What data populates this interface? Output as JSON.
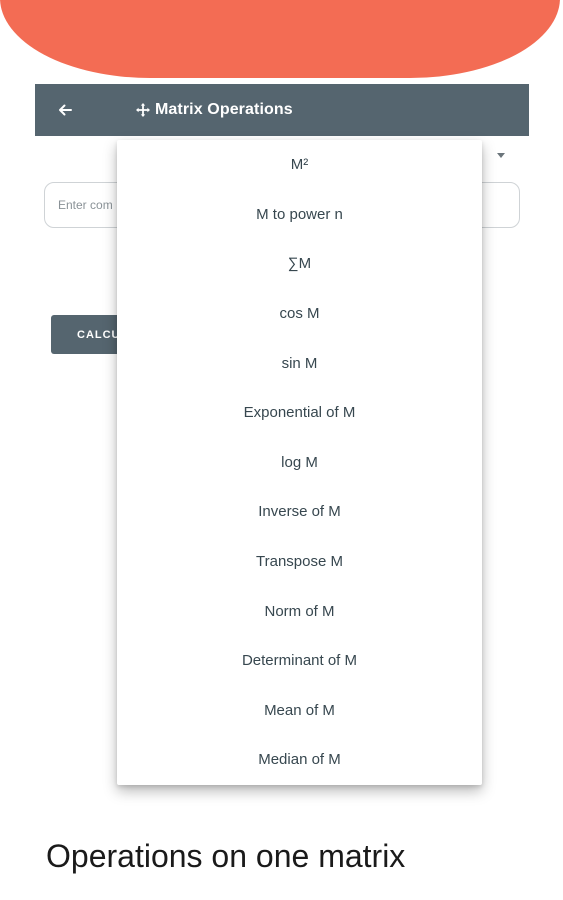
{
  "header": {
    "title": "Matrix Operations",
    "back_icon": "arrow-left-icon",
    "title_icon": "move-icon"
  },
  "form": {
    "input_placeholder": "Enter com",
    "calculate_label": "CALCU"
  },
  "dropdown": {
    "options": [
      "M²",
      "M to power n",
      "∑M",
      "cos M",
      "sin M",
      "Exponential of M",
      "log M",
      "Inverse of M",
      "Transpose M",
      "Norm of M",
      "Determinant of M",
      "Mean of M",
      "Median of M"
    ]
  },
  "caption": "Operations on one matrix",
  "colors": {
    "accent": "#f36c54",
    "appbar": "#55656f"
  }
}
